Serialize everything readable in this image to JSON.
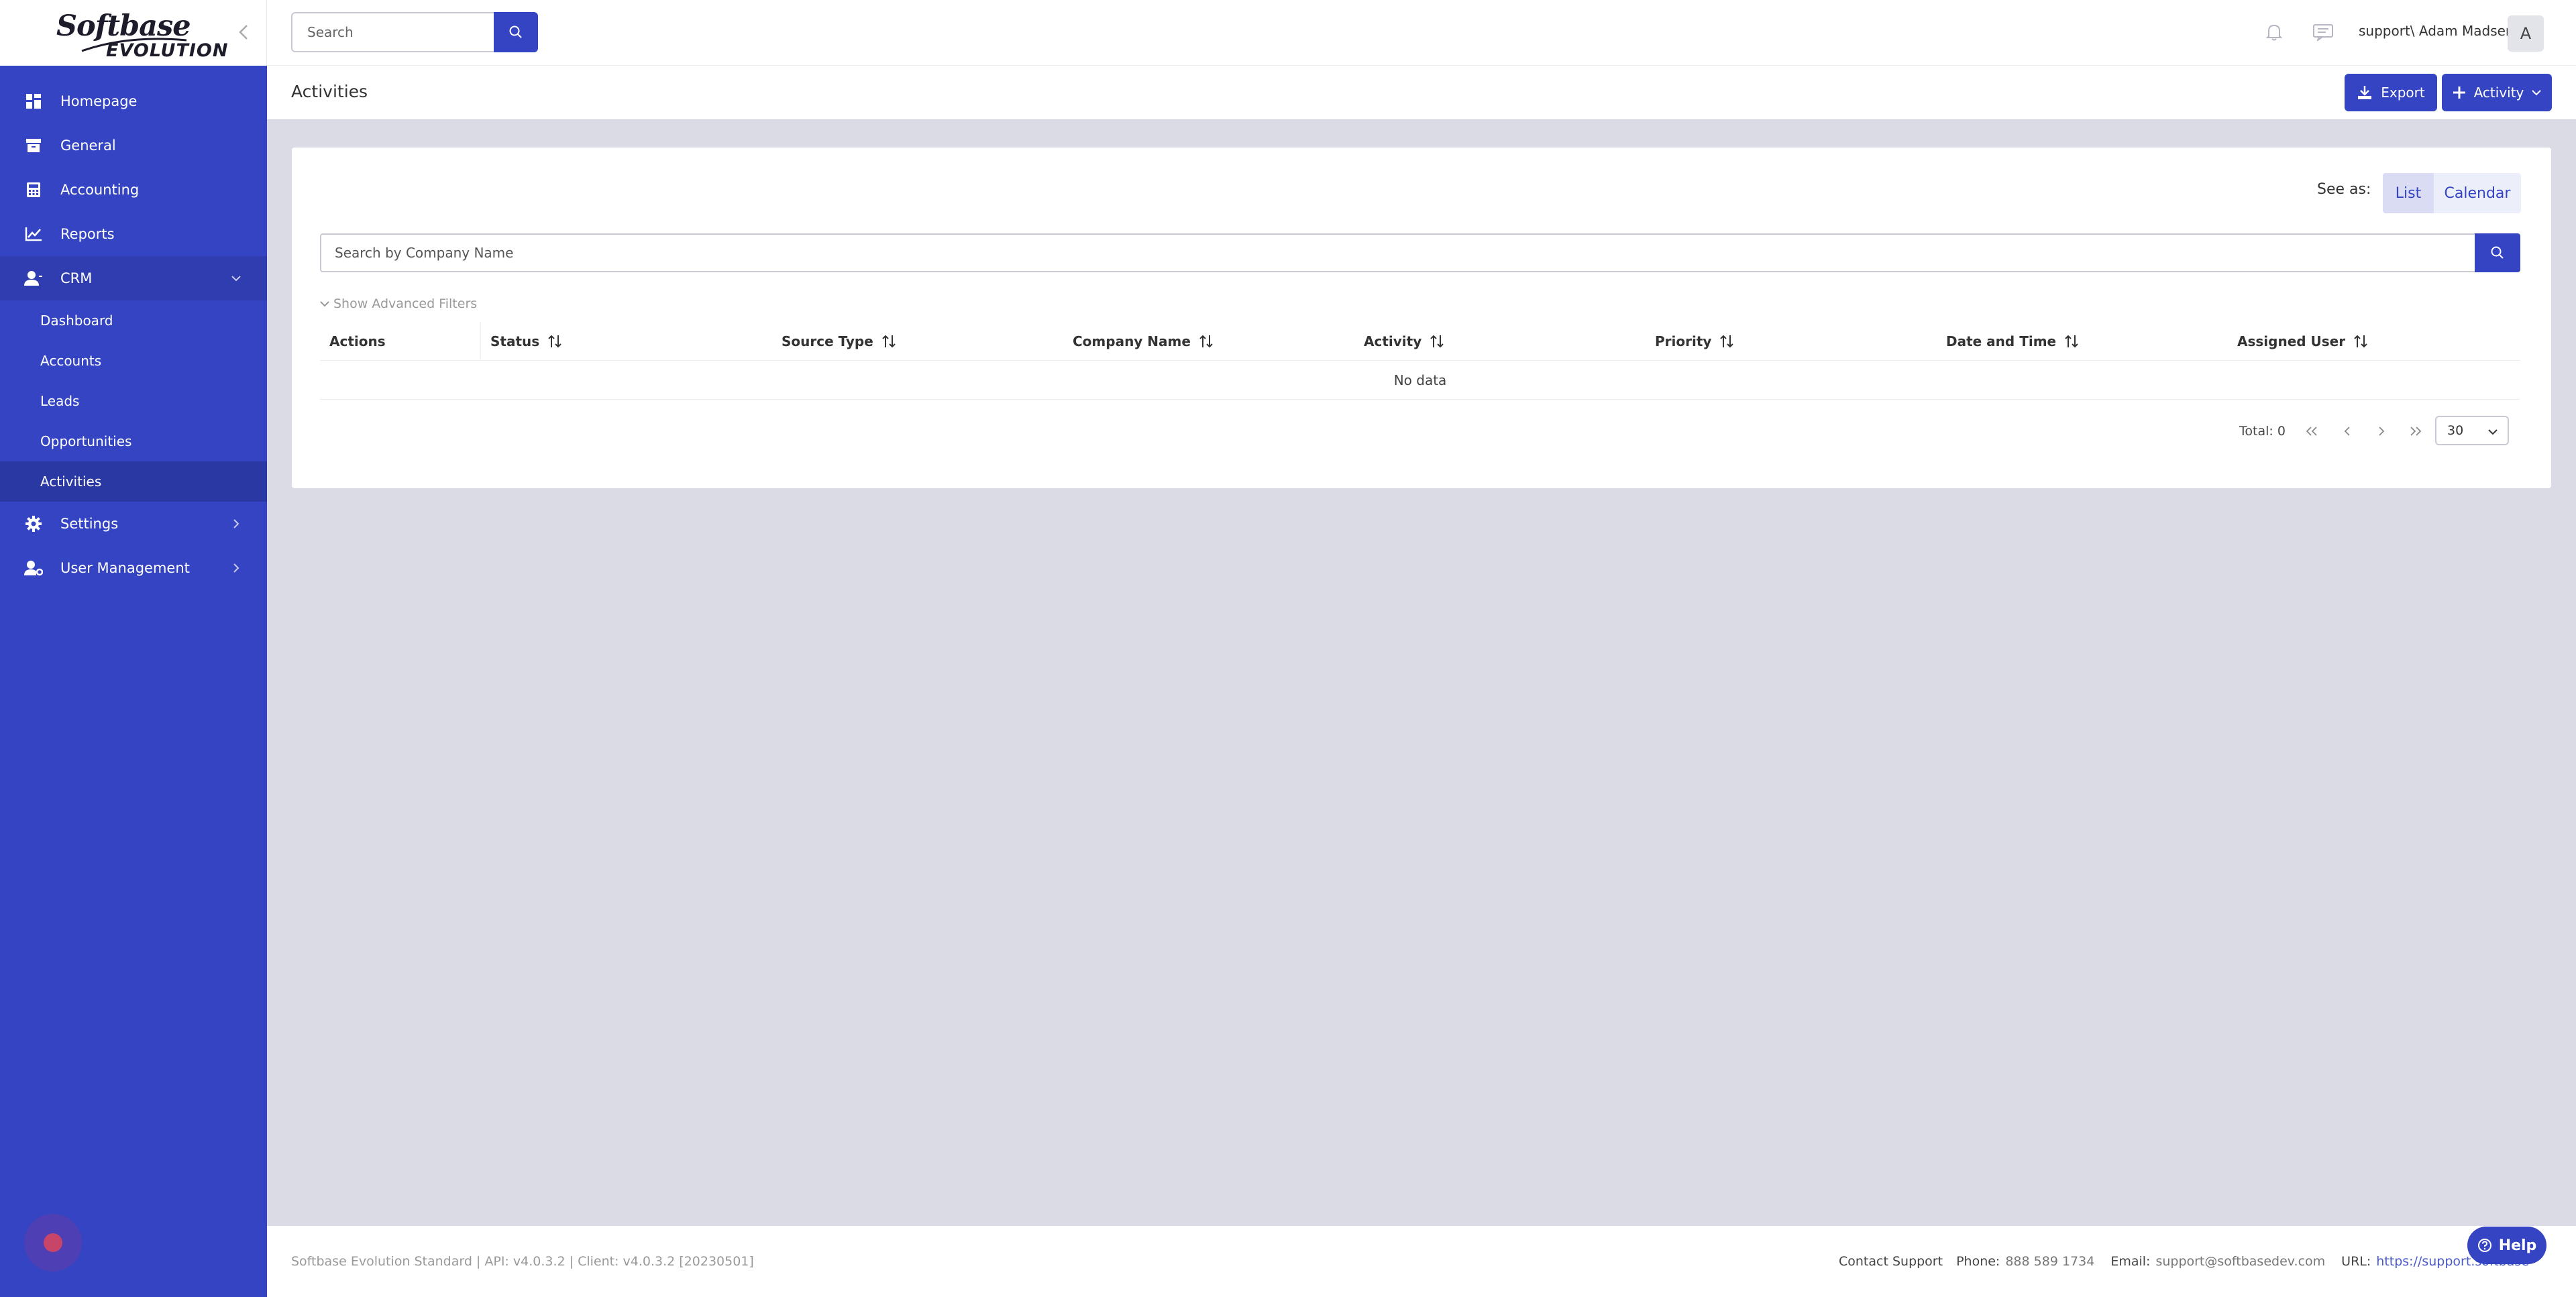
{
  "brand": {
    "logo_line1": "Softbase",
    "logo_line2": "EVOLUTION"
  },
  "sidebar": {
    "items": [
      {
        "label": "Homepage",
        "icon": "dashboard-grid-icon"
      },
      {
        "label": "General",
        "icon": "archive-box-icon"
      },
      {
        "label": "Accounting",
        "icon": "calculator-icon"
      },
      {
        "label": "Reports",
        "icon": "line-chart-icon"
      },
      {
        "label": "CRM",
        "icon": "user-icon",
        "expanded": true
      },
      {
        "label": "Settings",
        "icon": "gear-icon"
      },
      {
        "label": "User Management",
        "icon": "user-gear-icon"
      }
    ],
    "crm_sub": [
      "Dashboard",
      "Accounts",
      "Leads",
      "Opportunities",
      "Activities"
    ],
    "active_sub": "Activities"
  },
  "topbar": {
    "search_placeholder": "Search",
    "username": "support\\ Adam Madsen",
    "avatar_initial": "A"
  },
  "header": {
    "title": "Activities",
    "export_label": "Export",
    "activity_label": "Activity"
  },
  "view": {
    "see_as_label": "See as:",
    "list_label": "List",
    "calendar_label": "Calendar",
    "selected": "List"
  },
  "filters": {
    "company_placeholder": "Search by Company Name",
    "advanced_label": "Show Advanced Filters"
  },
  "table": {
    "columns": [
      "Actions",
      "Status",
      "Source Type",
      "Company Name",
      "Activity",
      "Priority",
      "Date and Time",
      "Assigned User"
    ],
    "empty_text": "No data"
  },
  "pagination": {
    "total_label": "Total: 0",
    "page_size": "30"
  },
  "footer": {
    "version": "Softbase Evolution Standard | API: v4.0.3.2 | Client: v4.0.3.2 [20230501]",
    "contact_support": "Contact Support",
    "phone_label": "Phone:",
    "phone_value": "888 589 1734",
    "email_label": "Email:",
    "email_value": "support@softbasedev.com",
    "url_label": "URL:",
    "url_value": "https://support.softbase",
    "help_label": "Help"
  },
  "colors": {
    "primary": "#3444c2",
    "sidebar_active": "#2a38a4",
    "background": "#dadbe5"
  }
}
